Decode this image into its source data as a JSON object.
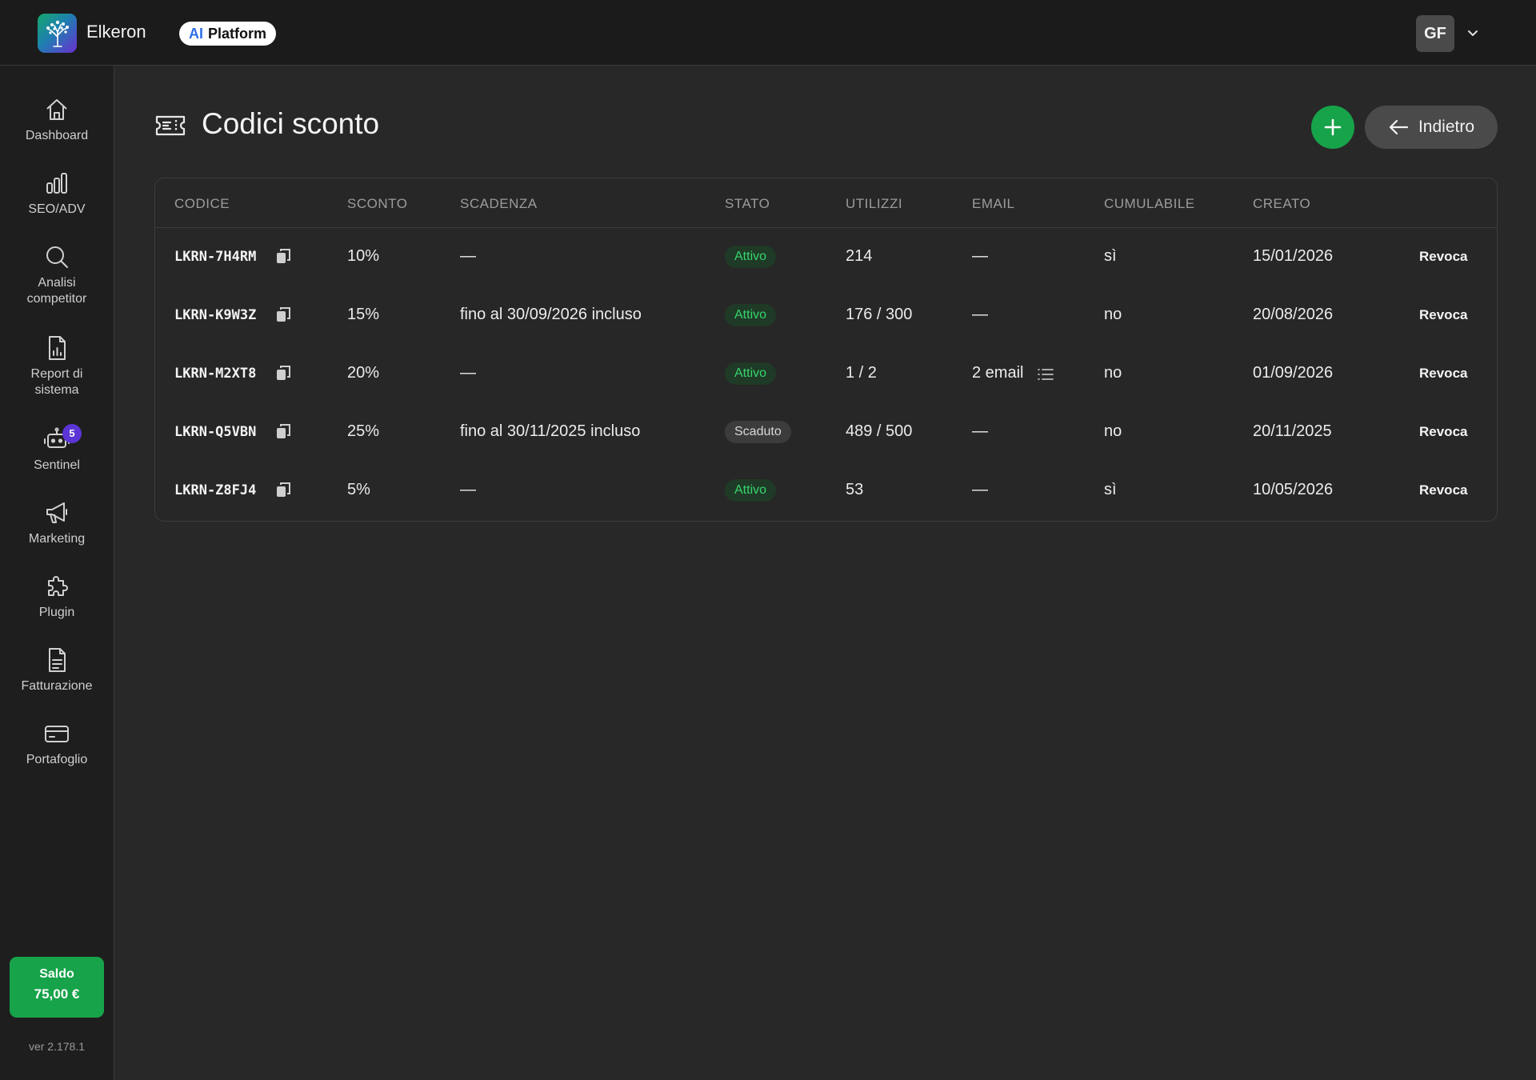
{
  "header": {
    "brand": "Elkeron",
    "platform_ai": "AI",
    "platform_label": "Platform",
    "user_initials": "GF"
  },
  "sidebar": {
    "items": [
      {
        "label": "Dashboard",
        "icon": "home-icon"
      },
      {
        "label": "SEO/ADV",
        "icon": "bar-chart-icon"
      },
      {
        "label": "Analisi competitor",
        "icon": "search-icon"
      },
      {
        "label": "Report di sistema",
        "icon": "report-icon"
      },
      {
        "label": "Sentinel",
        "icon": "robot-icon",
        "badge": "5"
      },
      {
        "label": "Marketing",
        "icon": "megaphone-icon"
      },
      {
        "label": "Plugin",
        "icon": "puzzle-icon"
      },
      {
        "label": "Fatturazione",
        "icon": "invoice-icon"
      },
      {
        "label": "Portafoglio",
        "icon": "wallet-icon"
      }
    ],
    "saldo_label": "Saldo",
    "saldo_value": "75,00 €",
    "version": "ver 2.178.1"
  },
  "page": {
    "title": "Codici sconto",
    "back_label": "Indietro"
  },
  "table": {
    "columns": [
      "CODICE",
      "SCONTO",
      "SCADENZA",
      "STATO",
      "UTILIZZI",
      "EMAIL",
      "CUMULABILE",
      "CREATO"
    ],
    "rows": [
      {
        "code": "LKRN-7H4RM",
        "discount": "10%",
        "expiry": "—",
        "status": "Attivo",
        "status_type": "active",
        "uses": "214",
        "email": "—",
        "cumulative": "sì",
        "created": "15/01/2026",
        "action": "Revoca"
      },
      {
        "code": "LKRN-K9W3Z",
        "discount": "15%",
        "expiry": "fino al 30/09/2026 incluso",
        "status": "Attivo",
        "status_type": "active",
        "uses": "176 / 300",
        "email": "—",
        "cumulative": "no",
        "created": "20/08/2026",
        "action": "Revoca"
      },
      {
        "code": "LKRN-M2XT8",
        "discount": "20%",
        "expiry": "—",
        "status": "Attivo",
        "status_type": "active",
        "uses": "1 / 2",
        "email": "2 email",
        "cumulative": "no",
        "created": "01/09/2026",
        "action": "Revoca"
      },
      {
        "code": "LKRN-Q5VBN",
        "discount": "25%",
        "expiry": "fino al 30/11/2025 incluso",
        "status": "Scaduto",
        "status_type": "expired",
        "uses": "489 / 500",
        "email": "—",
        "cumulative": "no",
        "created": "20/11/2025",
        "action": "Revoca"
      },
      {
        "code": "LKRN-Z8FJ4",
        "discount": "5%",
        "expiry": "—",
        "status": "Attivo",
        "status_type": "active",
        "uses": "53",
        "email": "—",
        "cumulative": "sì",
        "created": "10/05/2026",
        "action": "Revoca"
      }
    ]
  },
  "colors": {
    "accent_green": "#17a34a",
    "active_text": "#37d46e",
    "badge_purple": "#5b35d5"
  }
}
